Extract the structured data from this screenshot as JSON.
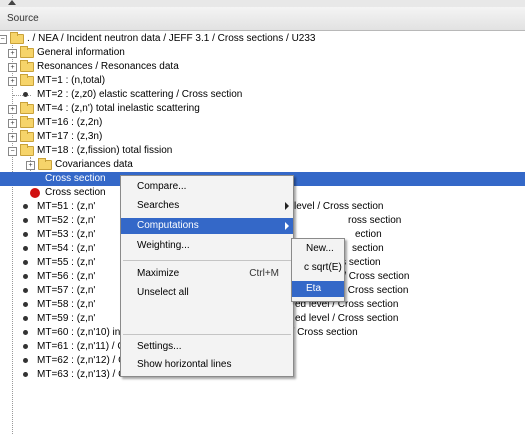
{
  "header": {
    "title": "Source"
  },
  "tree": {
    "root": ". / NEA / Incident neutron data / JEFF 3.1 / Cross sections / U233",
    "general": "General information",
    "resonances": "Resonances / Resonances data",
    "mt1": "MT=1 : (n,total)",
    "mt2": "MT=2 : (z,z0) elastic scattering / Cross section",
    "mt4": "MT=4 : (z,n') total inelastic scattering",
    "mt16": "MT=16 : (z,2n)",
    "mt17": "MT=17 : (z,3n)",
    "mt18": "MT=18 : (z,fission) total fission",
    "cov": "Covariances data",
    "cs1": "Cross section",
    "cs2": "Cross section",
    "mt51": "MT=51 : (z,n'",
    "mt52": "MT=52 : (z,n'",
    "mt53": "MT=53 : (z,n'",
    "mt54": "MT=54 : (z,n'",
    "mt55": "MT=55 : (z,n'",
    "mt56": "MT=56 : (z,n'",
    "mt57": "MT=57 : (z,n'",
    "mt58": "MT=58 : (z,n'",
    "mt59": "MT=59 : (z,n'",
    "mt60": "MT=60 : (z,n'10) inelastic scattering to tenth excited level / Cross section",
    "mt61": "MT=61 : (z,n'11) / Cross section",
    "mt62": "MT=62 : (z,n'12) / Cross section",
    "mt63": "MT=63 : (z,n'13) / Cross section",
    "tail51": "level / Cross section",
    "tail52": "ross section",
    "tail53": "ection",
    "tail54": "section",
    "tail55": "Cross section",
    "tail56": "ed level / Cross section",
    "tail57": "ited level / Cross section",
    "tail58": "ed level / Cross section",
    "tail59": "ed level / Cross section"
  },
  "context_menu": {
    "compare": "Compare...",
    "searches": "Searches",
    "computations": "Computations",
    "weighting": "Weighting...",
    "maximize": "Maximize",
    "maximize_shortcut": "Ctrl+M",
    "unselect": "Unselect all",
    "settings": "Settings...",
    "show_lines": "Show horizontal lines"
  },
  "submenu": {
    "new": "New...",
    "sqrt": "c sqrt(E)",
    "eta": "Eta"
  },
  "colors": {
    "selection": "#3468c8",
    "folder": "#f6d46a",
    "red_marker": "#d01010"
  }
}
